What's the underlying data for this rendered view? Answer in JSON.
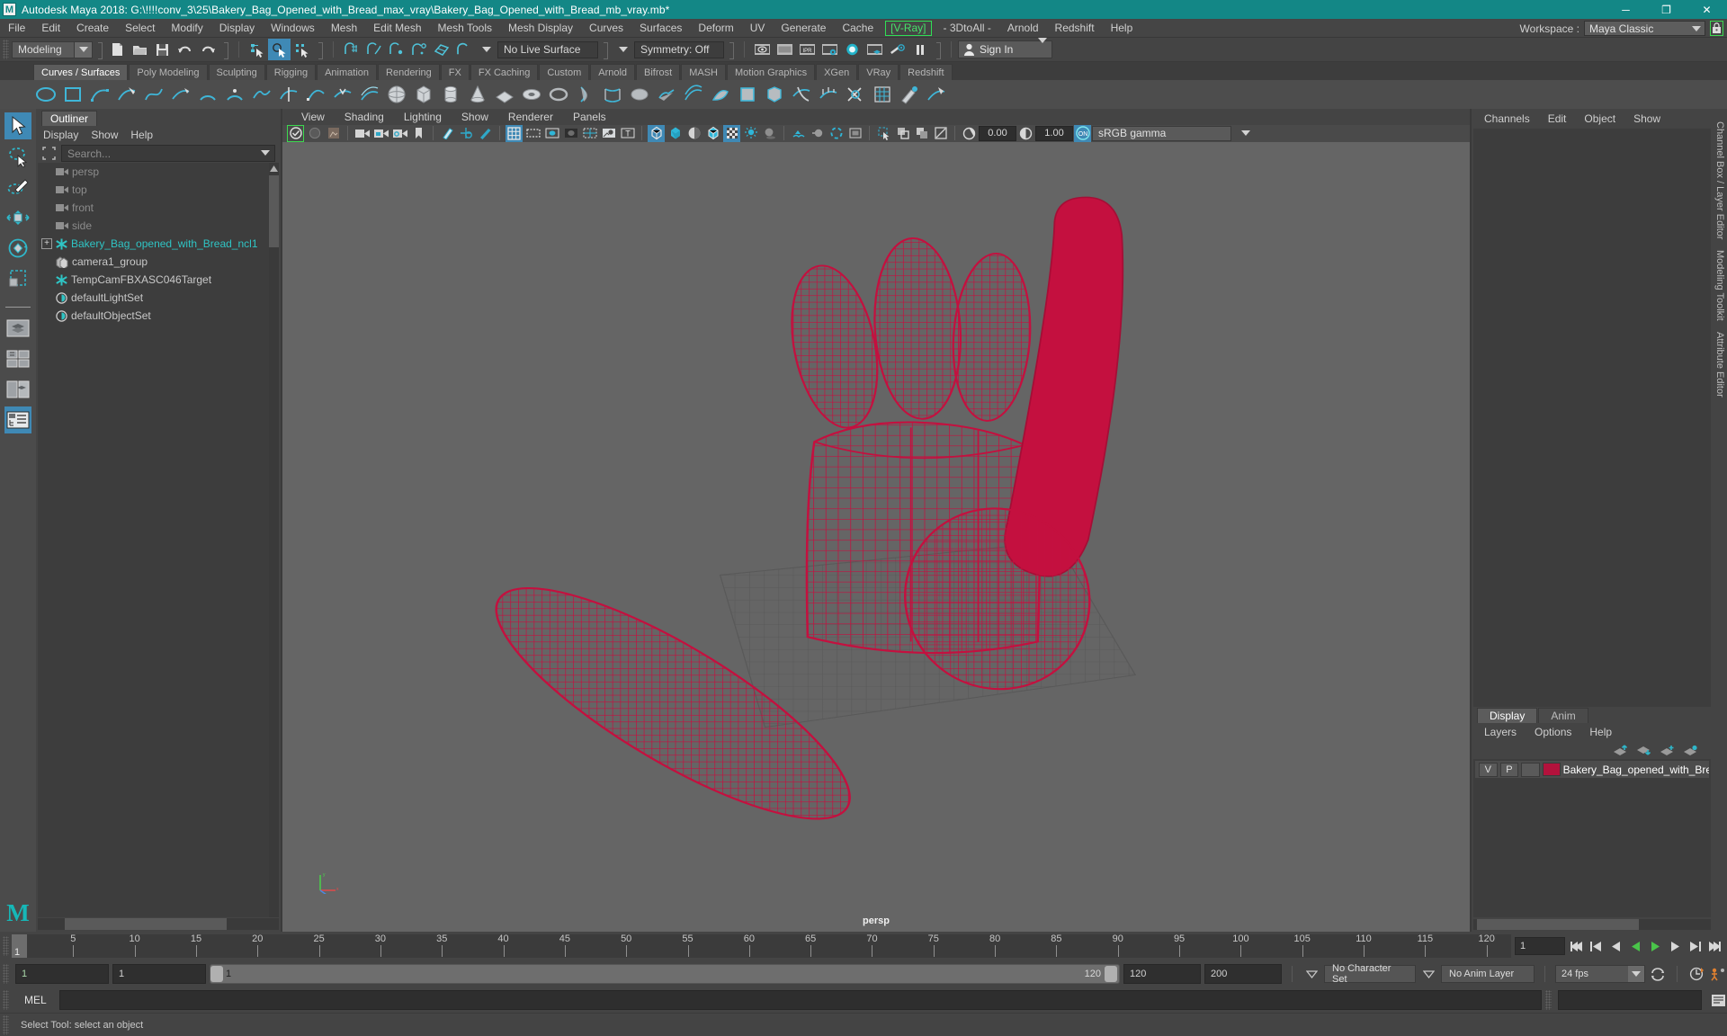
{
  "titlebar": {
    "app_icon": "maya-logo-icon",
    "title": "Autodesk Maya 2018: G:\\!!!!conv_3\\25\\Bakery_Bag_Opened_with_Bread_max_vray\\Bakery_Bag_Opened_with_Bread_mb_vray.mb*",
    "minimize": "─",
    "maximize": "❐",
    "close": "✕"
  },
  "menubar": {
    "items": [
      "File",
      "Edit",
      "Create",
      "Select",
      "Modify",
      "Display",
      "Windows",
      "Mesh",
      "Edit Mesh",
      "Mesh Tools",
      "Mesh Display",
      "Curves",
      "Surfaces",
      "Deform",
      "UV",
      "Generate",
      "Cache"
    ],
    "vray": "[V-Ray]",
    "after_vray": [
      "- 3DtoAll -",
      "Arnold",
      "Redshift",
      "Help"
    ],
    "workspace_label": "Workspace :",
    "workspace_value": "Maya Classic",
    "lock_icon": "lock-icon"
  },
  "statusline": {
    "menuset": "Modeling",
    "live_surface": "No Live Surface",
    "symmetry": "Symmetry: Off",
    "signin": "Sign In",
    "icons": [
      "new-scene-icon",
      "open-scene-icon",
      "save-scene-icon",
      "undo-icon",
      "redo-icon",
      "select-by-hierarchy-icon",
      "select-by-object-icon",
      "select-by-component-icon",
      "snap-to-grid-icon",
      "snap-to-curve-icon",
      "snap-to-point-icon",
      "snap-to-projected-center-icon",
      "snap-to-view-plane-icon",
      "make-live-icon",
      "render-view-icon",
      "render-region-icon",
      "ipr-render-icon",
      "render-settings-icon",
      "hypershade-icon",
      "render-setup-icon",
      "light-editor-icon",
      "pause-icon"
    ]
  },
  "shelf": {
    "tabs": [
      {
        "label": "Curves / Surfaces",
        "active": true
      },
      {
        "label": "Poly Modeling",
        "active": false
      },
      {
        "label": "Sculpting",
        "active": false
      },
      {
        "label": "Rigging",
        "active": false
      },
      {
        "label": "Animation",
        "active": false
      },
      {
        "label": "Rendering",
        "active": false
      },
      {
        "label": "FX",
        "active": false
      },
      {
        "label": "FX Caching",
        "active": false
      },
      {
        "label": "Custom",
        "active": false
      },
      {
        "label": "Arnold",
        "active": false
      },
      {
        "label": "Bifrost",
        "active": false
      },
      {
        "label": "MASH",
        "active": false
      },
      {
        "label": "Motion Graphics",
        "active": false
      },
      {
        "label": "XGen",
        "active": false
      },
      {
        "label": "VRay",
        "active": false
      },
      {
        "label": "Redshift",
        "active": false
      }
    ]
  },
  "toolbox": {
    "tools": [
      {
        "name": "select-tool",
        "selected": true
      },
      {
        "name": "lasso-select-tool",
        "selected": false
      },
      {
        "name": "paint-select-tool",
        "selected": false
      },
      {
        "name": "move-tool",
        "selected": false
      },
      {
        "name": "rotate-tool",
        "selected": false
      },
      {
        "name": "scale-tool",
        "selected": false
      }
    ],
    "layouts": [
      {
        "name": "single-perspective-layout",
        "selected": false
      },
      {
        "name": "four-view-layout",
        "selected": false
      },
      {
        "name": "two-pane-layout",
        "selected": false
      },
      {
        "name": "outliner-persp-layout",
        "selected": true
      }
    ]
  },
  "outliner": {
    "tab": "Outliner",
    "menu": [
      "Display",
      "Show",
      "Help"
    ],
    "search_placeholder": "Search...",
    "items": [
      {
        "label": "persp",
        "icon": "camera-icon",
        "dim": true,
        "expandable": false,
        "indent": 1
      },
      {
        "label": "top",
        "icon": "camera-icon",
        "dim": true,
        "expandable": false,
        "indent": 1
      },
      {
        "label": "front",
        "icon": "camera-icon",
        "dim": true,
        "expandable": false,
        "indent": 1
      },
      {
        "label": "side",
        "icon": "camera-icon",
        "dim": true,
        "expandable": false,
        "indent": 1
      },
      {
        "label": "Bakery_Bag_opened_with_Bread_ncl1",
        "icon": "transform-icon",
        "dim": false,
        "expandable": true,
        "indent": 0
      },
      {
        "label": "camera1_group",
        "icon": "group-icon",
        "dim": false,
        "expandable": false,
        "indent": 1
      },
      {
        "label": "TempCamFBXASC046Target",
        "icon": "transform-icon",
        "dim": false,
        "expandable": false,
        "indent": 1
      },
      {
        "label": "defaultLightSet",
        "icon": "set-icon",
        "dim": false,
        "expandable": false,
        "indent": 1
      },
      {
        "label": "defaultObjectSet",
        "icon": "set-icon",
        "dim": false,
        "expandable": false,
        "indent": 1
      }
    ]
  },
  "viewport": {
    "menu": [
      "View",
      "Shading",
      "Lighting",
      "Show",
      "Renderer",
      "Panels"
    ],
    "exposure_value": "0.00",
    "gamma_value": "1.00",
    "color_management": "sRGB gamma",
    "camera_label": "persp",
    "wireframe_color": "#c4103f",
    "background_color": "#656565",
    "icons": [
      "select-camera-icon",
      "lock-camera-icon",
      "camera-attributes-icon",
      "bookmark-icon",
      "image-plane-icon",
      "two-d-pan-zoom-icon",
      "grease-pencil-icon",
      "grid-icon",
      "film-gate-icon",
      "resolution-gate-icon",
      "gate-mask-icon",
      "field-chart-icon",
      "safe-action-icon",
      "safe-title-icon",
      "wireframe-icon",
      "smooth-shade-icon",
      "flat-shade-icon",
      "shaded-wireframe-icon",
      "textured-icon",
      "use-default-lighting-icon",
      "shadows-icon",
      "ao-icon",
      "motion-blur-icon",
      "aa-icon",
      "multisample-icon",
      "isolate-select-icon",
      "xray-icon",
      "xray-joints-icon",
      "xray-active-components-icon",
      "exposure-icon",
      "gamma-icon",
      "color-management-icon"
    ]
  },
  "right_panel": {
    "menu": [
      "Channels",
      "Edit",
      "Object",
      "Show"
    ],
    "vertical_tabs": [
      "Channel Box / Layer Editor",
      "Modeling Toolkit",
      "Attribute Editor"
    ],
    "display_tabs": [
      {
        "label": "Display",
        "active": true
      },
      {
        "label": "Anim",
        "active": false
      }
    ],
    "layers_menu": [
      "Layers",
      "Options",
      "Help"
    ],
    "layer_buttons": [
      "move-layer-up-icon",
      "move-layer-down-icon",
      "new-layer-icon",
      "new-layer-from-selected-icon"
    ],
    "layers": [
      {
        "visible": "V",
        "playback": "P",
        "type": "",
        "color": "#b3123c",
        "name": "Bakery_Bag_opened_with_Bre"
      }
    ]
  },
  "timeline": {
    "current_frame": "1",
    "ticks": [
      5,
      10,
      15,
      20,
      25,
      30,
      35,
      40,
      45,
      50,
      55,
      60,
      65,
      70,
      75,
      80,
      85,
      90,
      95,
      100,
      105,
      110,
      115,
      120
    ],
    "frame_field": "1",
    "playback_buttons": [
      "go-to-start-icon",
      "step-back-frame-icon",
      "step-back-key-icon",
      "play-backwards-icon",
      "play-forwards-icon",
      "step-forward-key-icon",
      "step-forward-frame-icon",
      "go-to-end-icon"
    ]
  },
  "range_slider": {
    "anim_start": "1",
    "range_start": "1",
    "bar_start_label": "1",
    "bar_end_label": "120",
    "range_end": "120",
    "anim_end": "200",
    "character_set": "No Character Set",
    "anim_layer": "No Anim Layer",
    "fps": "24 fps",
    "buttons": [
      "auto-keyframe-icon",
      "animation-preferences-icon",
      "loop-playback-icon"
    ]
  },
  "command_line": {
    "language": "MEL",
    "input_value": "",
    "output_value": ""
  },
  "help_line": {
    "text": "Select Tool: select an object"
  }
}
